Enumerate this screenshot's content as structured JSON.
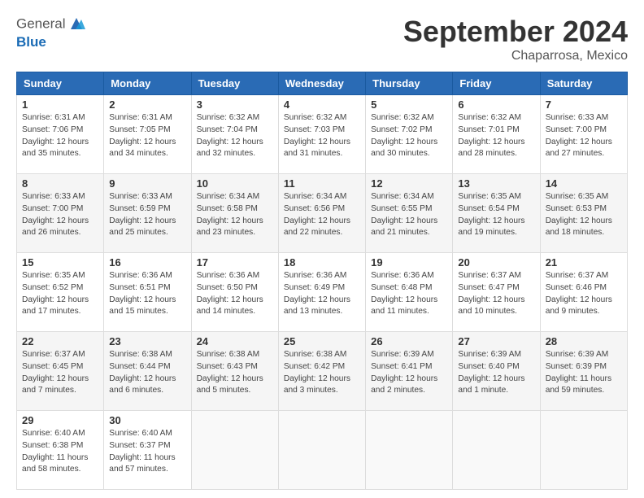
{
  "header": {
    "logo_line1": "General",
    "logo_line2": "Blue",
    "month": "September 2024",
    "location": "Chaparrosa, Mexico"
  },
  "weekdays": [
    "Sunday",
    "Monday",
    "Tuesday",
    "Wednesday",
    "Thursday",
    "Friday",
    "Saturday"
  ],
  "weeks": [
    [
      {
        "day": "1",
        "sunrise": "6:31 AM",
        "sunset": "7:06 PM",
        "daylight": "12 hours and 35 minutes."
      },
      {
        "day": "2",
        "sunrise": "6:31 AM",
        "sunset": "7:05 PM",
        "daylight": "12 hours and 34 minutes."
      },
      {
        "day": "3",
        "sunrise": "6:32 AM",
        "sunset": "7:04 PM",
        "daylight": "12 hours and 32 minutes."
      },
      {
        "day": "4",
        "sunrise": "6:32 AM",
        "sunset": "7:03 PM",
        "daylight": "12 hours and 31 minutes."
      },
      {
        "day": "5",
        "sunrise": "6:32 AM",
        "sunset": "7:02 PM",
        "daylight": "12 hours and 30 minutes."
      },
      {
        "day": "6",
        "sunrise": "6:32 AM",
        "sunset": "7:01 PM",
        "daylight": "12 hours and 28 minutes."
      },
      {
        "day": "7",
        "sunrise": "6:33 AM",
        "sunset": "7:00 PM",
        "daylight": "12 hours and 27 minutes."
      }
    ],
    [
      {
        "day": "8",
        "sunrise": "6:33 AM",
        "sunset": "7:00 PM",
        "daylight": "12 hours and 26 minutes."
      },
      {
        "day": "9",
        "sunrise": "6:33 AM",
        "sunset": "6:59 PM",
        "daylight": "12 hours and 25 minutes."
      },
      {
        "day": "10",
        "sunrise": "6:34 AM",
        "sunset": "6:58 PM",
        "daylight": "12 hours and 23 minutes."
      },
      {
        "day": "11",
        "sunrise": "6:34 AM",
        "sunset": "6:56 PM",
        "daylight": "12 hours and 22 minutes."
      },
      {
        "day": "12",
        "sunrise": "6:34 AM",
        "sunset": "6:55 PM",
        "daylight": "12 hours and 21 minutes."
      },
      {
        "day": "13",
        "sunrise": "6:35 AM",
        "sunset": "6:54 PM",
        "daylight": "12 hours and 19 minutes."
      },
      {
        "day": "14",
        "sunrise": "6:35 AM",
        "sunset": "6:53 PM",
        "daylight": "12 hours and 18 minutes."
      }
    ],
    [
      {
        "day": "15",
        "sunrise": "6:35 AM",
        "sunset": "6:52 PM",
        "daylight": "12 hours and 17 minutes."
      },
      {
        "day": "16",
        "sunrise": "6:36 AM",
        "sunset": "6:51 PM",
        "daylight": "12 hours and 15 minutes."
      },
      {
        "day": "17",
        "sunrise": "6:36 AM",
        "sunset": "6:50 PM",
        "daylight": "12 hours and 14 minutes."
      },
      {
        "day": "18",
        "sunrise": "6:36 AM",
        "sunset": "6:49 PM",
        "daylight": "12 hours and 13 minutes."
      },
      {
        "day": "19",
        "sunrise": "6:36 AM",
        "sunset": "6:48 PM",
        "daylight": "12 hours and 11 minutes."
      },
      {
        "day": "20",
        "sunrise": "6:37 AM",
        "sunset": "6:47 PM",
        "daylight": "12 hours and 10 minutes."
      },
      {
        "day": "21",
        "sunrise": "6:37 AM",
        "sunset": "6:46 PM",
        "daylight": "12 hours and 9 minutes."
      }
    ],
    [
      {
        "day": "22",
        "sunrise": "6:37 AM",
        "sunset": "6:45 PM",
        "daylight": "12 hours and 7 minutes."
      },
      {
        "day": "23",
        "sunrise": "6:38 AM",
        "sunset": "6:44 PM",
        "daylight": "12 hours and 6 minutes."
      },
      {
        "day": "24",
        "sunrise": "6:38 AM",
        "sunset": "6:43 PM",
        "daylight": "12 hours and 5 minutes."
      },
      {
        "day": "25",
        "sunrise": "6:38 AM",
        "sunset": "6:42 PM",
        "daylight": "12 hours and 3 minutes."
      },
      {
        "day": "26",
        "sunrise": "6:39 AM",
        "sunset": "6:41 PM",
        "daylight": "12 hours and 2 minutes."
      },
      {
        "day": "27",
        "sunrise": "6:39 AM",
        "sunset": "6:40 PM",
        "daylight": "12 hours and 1 minute."
      },
      {
        "day": "28",
        "sunrise": "6:39 AM",
        "sunset": "6:39 PM",
        "daylight": "11 hours and 59 minutes."
      }
    ],
    [
      {
        "day": "29",
        "sunrise": "6:40 AM",
        "sunset": "6:38 PM",
        "daylight": "11 hours and 58 minutes."
      },
      {
        "day": "30",
        "sunrise": "6:40 AM",
        "sunset": "6:37 PM",
        "daylight": "11 hours and 57 minutes."
      },
      null,
      null,
      null,
      null,
      null
    ]
  ]
}
